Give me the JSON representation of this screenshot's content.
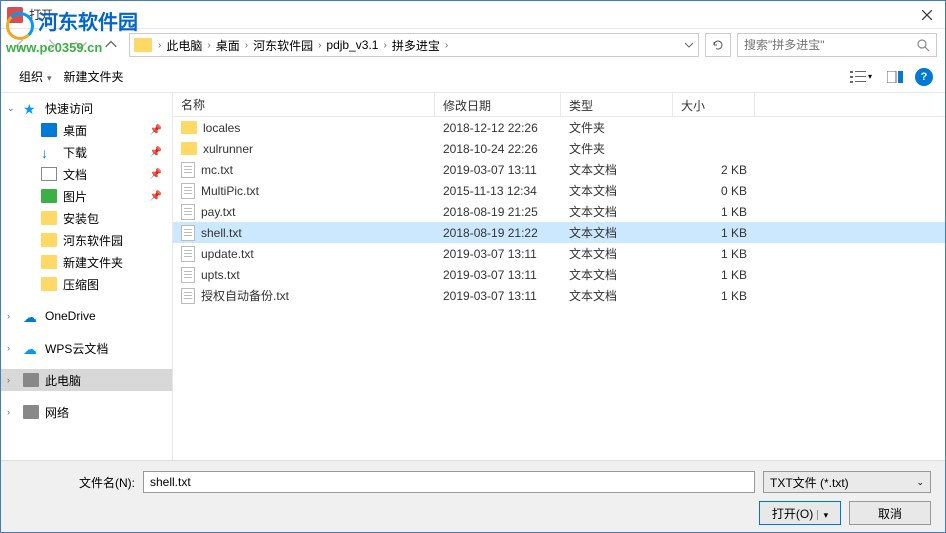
{
  "window": {
    "title": "打开"
  },
  "watermark": {
    "title": "河东软件园",
    "url": "www.pc0359.cn"
  },
  "breadcrumb": {
    "items": [
      "此电脑",
      "桌面",
      "河东软件园",
      "pdjb_v3.1",
      "拼多进宝"
    ]
  },
  "search": {
    "placeholder": "搜索\"拼多进宝\""
  },
  "toolbar": {
    "organize": "组织",
    "newfolder": "新建文件夹"
  },
  "columns": {
    "name": "名称",
    "date": "修改日期",
    "type": "类型",
    "size": "大小"
  },
  "sidebar": {
    "quick": "快速访问",
    "desktop": "桌面",
    "download": "下载",
    "doc": "文档",
    "pic": "图片",
    "pkg": "安装包",
    "hd": "河东软件园",
    "newfolder": "新建文件夹",
    "zip": "压缩图",
    "onedrive": "OneDrive",
    "wps": "WPS云文档",
    "thispc": "此电脑",
    "network": "网络"
  },
  "files": [
    {
      "name": "locales",
      "date": "2018-12-12  22:26",
      "type": "文件夹",
      "size": "",
      "folder": true
    },
    {
      "name": "xulrunner",
      "date": "2018-10-24  22:26",
      "type": "文件夹",
      "size": "",
      "folder": true
    },
    {
      "name": "mc.txt",
      "date": "2019-03-07  13:11",
      "type": "文本文档",
      "size": "2 KB"
    },
    {
      "name": "MultiPic.txt",
      "date": "2015-11-13  12:34",
      "type": "文本文档",
      "size": "0 KB"
    },
    {
      "name": "pay.txt",
      "date": "2018-08-19  21:25",
      "type": "文本文档",
      "size": "1 KB"
    },
    {
      "name": "shell.txt",
      "date": "2018-08-19  21:22",
      "type": "文本文档",
      "size": "1 KB",
      "selected": true
    },
    {
      "name": "update.txt",
      "date": "2019-03-07  13:11",
      "type": "文本文档",
      "size": "1 KB"
    },
    {
      "name": "upts.txt",
      "date": "2019-03-07  13:11",
      "type": "文本文档",
      "size": "1 KB"
    },
    {
      "name": "授权自动备份.txt",
      "date": "2019-03-07  13:11",
      "type": "文本文档",
      "size": "1 KB"
    }
  ],
  "footer": {
    "filename_label": "文件名(N):",
    "filename_value": "shell.txt",
    "filter": "TXT文件 (*.txt)",
    "open": "打开(O)",
    "cancel": "取消"
  }
}
